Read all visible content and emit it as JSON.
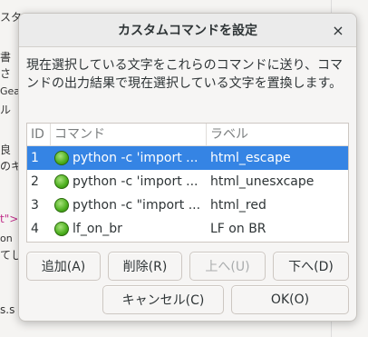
{
  "background": {
    "lines": [
      "スタ",
      "書",
      "さ",
      "Gea",
      "ル",
      "良",
      "のキ",
      "t\">",
      "on",
      "てし",
      "s.s"
    ]
  },
  "dialog": {
    "title": "カスタムコマンドを設定",
    "close_icon": "×",
    "description": "現在選択している文字をこれらのコマンドに送り、コマンドの出力結果で現在選択している文字を置換します。",
    "table": {
      "headers": {
        "id": "ID",
        "command": "コマンド",
        "label": "ラベル"
      },
      "rows": [
        {
          "id": "1",
          "command": "python -c 'import ...",
          "label": "html_escape",
          "selected": true
        },
        {
          "id": "2",
          "command": "python -c 'import ...",
          "label": "html_unesxcape",
          "selected": false
        },
        {
          "id": "3",
          "command": "python -c \"import ...",
          "label": "html_red",
          "selected": false
        },
        {
          "id": "4",
          "command": "lf_on_br",
          "label": "LF on BR",
          "selected": false
        }
      ]
    },
    "buttons": {
      "add": "追加(A)",
      "delete": "削除(R)",
      "up": "上へ(U)",
      "down": "下へ(D)",
      "cancel": "キャンセル(C)",
      "ok": "OK(O)"
    },
    "colors": {
      "selection": "#3584e4",
      "icon_green": "#4caf1e"
    }
  }
}
